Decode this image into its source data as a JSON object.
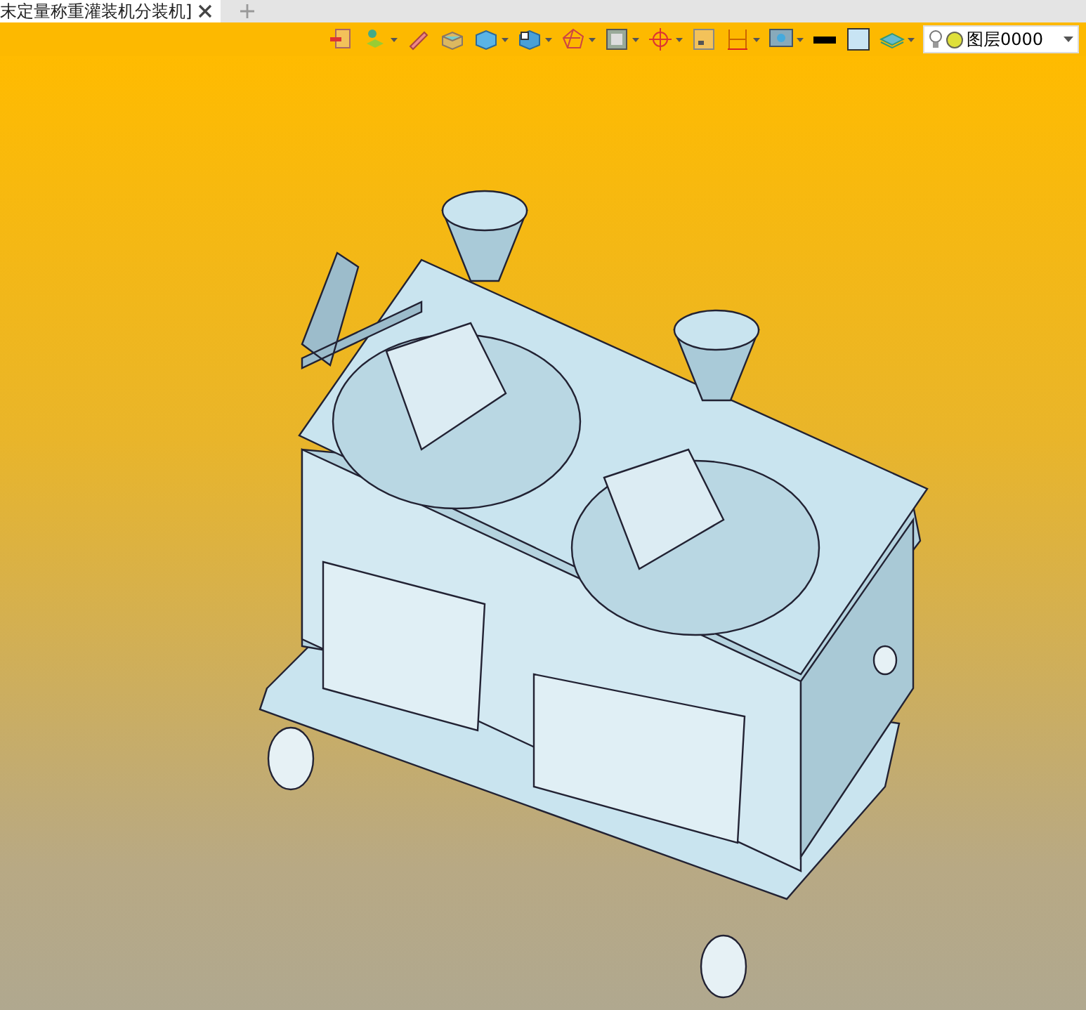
{
  "tab_bar": {
    "tabs": [
      {
        "title": "末定量称重灌装机分装机]",
        "selected": true
      }
    ]
  },
  "toolbar": {
    "layer_combo": {
      "value": "图层0000"
    }
  }
}
